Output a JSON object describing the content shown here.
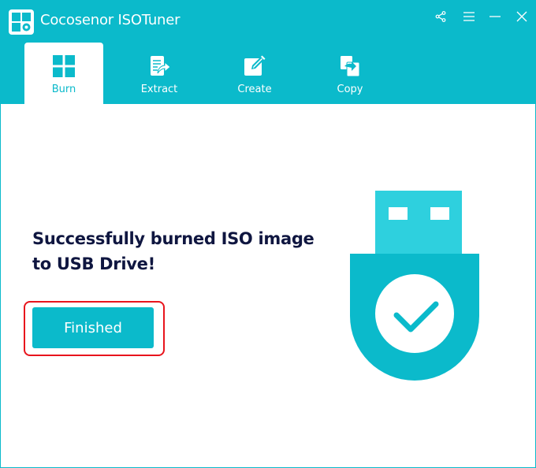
{
  "app": {
    "title": "Cocosenor ISOTuner",
    "logo_icon": "app-logo-icon",
    "brand_color": "#0bbacb"
  },
  "window_controls": [
    {
      "name": "share",
      "icon": "share-icon"
    },
    {
      "name": "menu",
      "icon": "menu-icon"
    },
    {
      "name": "minimize",
      "icon": "minimize-icon"
    },
    {
      "name": "close",
      "icon": "close-icon"
    }
  ],
  "tabs": [
    {
      "label": "Burn",
      "icon": "grid-icon",
      "active": true
    },
    {
      "label": "Extract",
      "icon": "extract-icon",
      "active": false
    },
    {
      "label": "Create",
      "icon": "edit-icon",
      "active": false
    },
    {
      "label": "Copy",
      "icon": "copy-icon",
      "active": false
    }
  ],
  "main": {
    "message_line1": "Successfully burned ISO image",
    "message_line2": "to USB Drive!",
    "finish_button_label": "Finished",
    "illustration": "usb-success-icon",
    "highlight_color": "#e8141c"
  }
}
